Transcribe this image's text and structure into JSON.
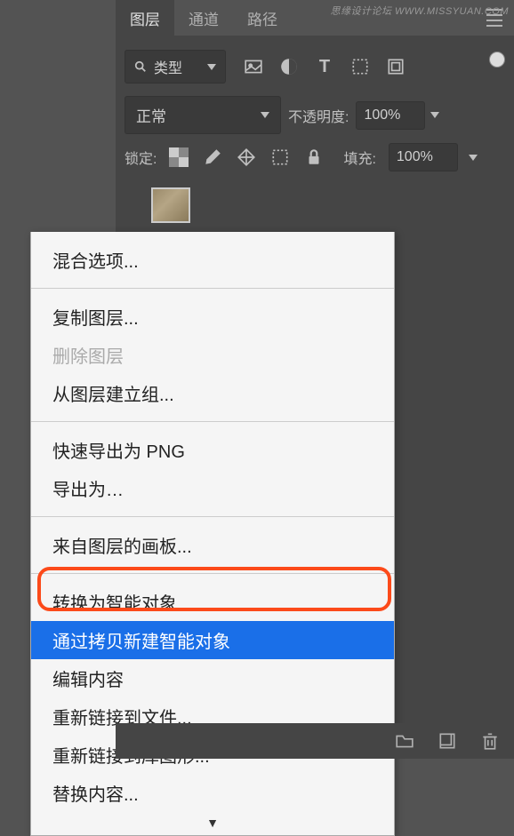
{
  "watermark": "思缘设计论坛  WWW.MISSYUAN.COM",
  "tabs": {
    "layers": "图层",
    "channels": "通道",
    "paths": "路径"
  },
  "filterRow": {
    "typeLabel": "类型"
  },
  "blendRow": {
    "mode": "正常",
    "opacityLabel": "不透明度:",
    "opacityValue": "100%"
  },
  "lockRow": {
    "label": "锁定:",
    "fillLabel": "填充:",
    "fillValue": "100%"
  },
  "menu": {
    "blendOptions": "混合选项...",
    "duplicate": "复制图层...",
    "delete": "删除图层",
    "groupFromLayers": "从图层建立组...",
    "quickExportPNG": "快速导出为 PNG",
    "exportAs": "导出为…",
    "artboardFromLayers": "来自图层的画板...",
    "convertSmartObject": "转换为智能对象",
    "newSmartObjectViaCopy": "通过拷贝新建智能对象",
    "editContents": "编辑内容",
    "relinkToFile": "重新链接到文件...",
    "relinkToLibrary": "重新链接到库图形...",
    "replaceContents": "替换内容..."
  }
}
